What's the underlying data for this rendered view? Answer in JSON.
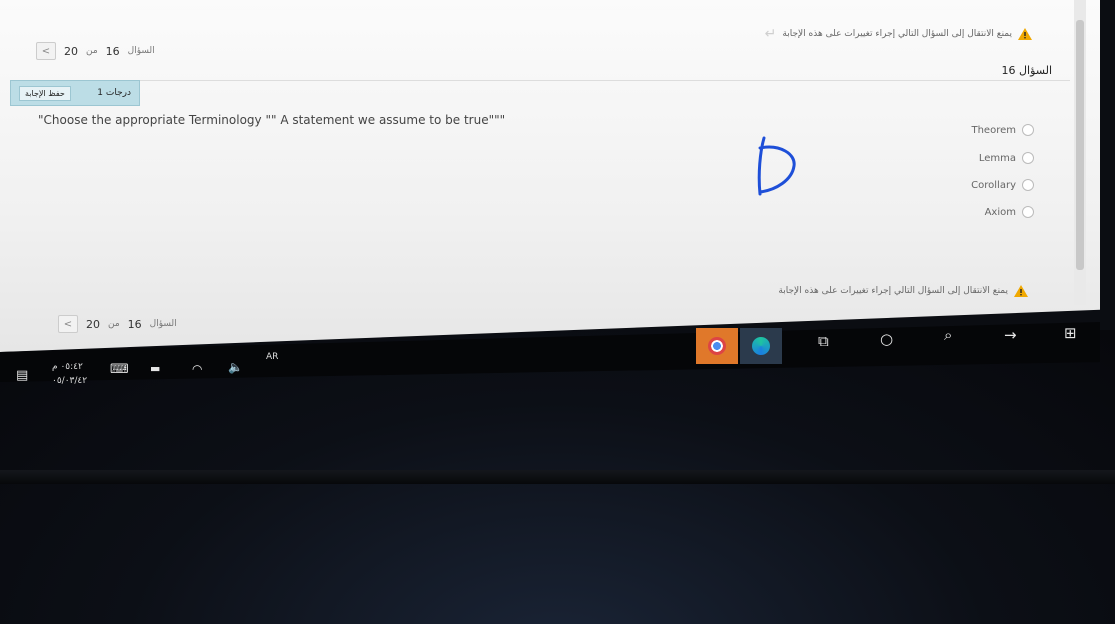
{
  "warning": {
    "text": "يمنع الانتقال إلى السؤال التالي إجراء تغييرات على هذه الإجابة"
  },
  "nav_top": {
    "label": "السؤال",
    "current": "16",
    "of": "من",
    "total": "20"
  },
  "nav_bottom": {
    "label": "السؤال",
    "current": "16",
    "of": "من",
    "total": "20"
  },
  "question": {
    "title": "السؤال 16",
    "grade_label": "1 درجات",
    "save_label": "حفظ الإجابة",
    "stem": "\"Choose the appropriate Terminology \"\" A statement we assume to be true\"\"\"",
    "options": [
      "Theorem",
      "Lemma",
      "Corollary",
      "Axiom"
    ]
  },
  "annotation": {
    "letter": "D",
    "color": "#1e4fd8"
  },
  "taskbar": {
    "lang": "AR",
    "time": "٠٥:٤٢ م",
    "date": "٠٥/٠٣/٤٢"
  },
  "colors": {
    "badge_bg": "#bcdde6",
    "warning": "#f0a800",
    "app_orange": "#e0782a"
  }
}
